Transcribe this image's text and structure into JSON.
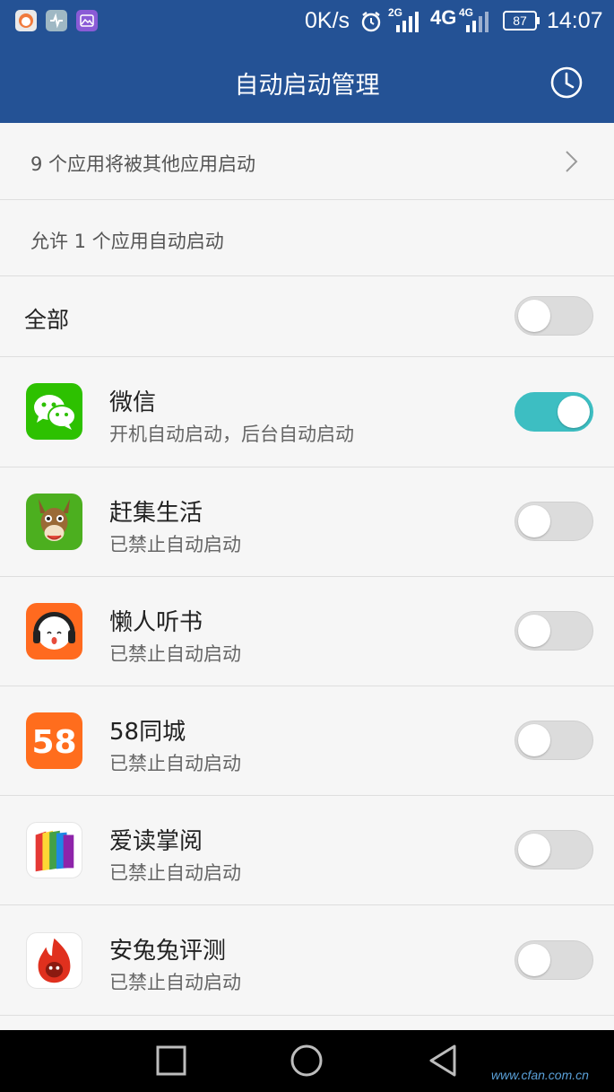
{
  "status_bar": {
    "speed": "0K/s",
    "net_2g": "2G",
    "net_4g": "4G",
    "net_4g_small": "4G",
    "battery": "87",
    "time": "14:07",
    "icons": [
      "headset-app-icon",
      "health-app-icon",
      "gallery-app-icon",
      "alarm-icon",
      "signal-icon",
      "battery-icon"
    ]
  },
  "header": {
    "title": "自动启动管理",
    "history_icon": "clock-icon"
  },
  "summary": {
    "launched_by_others": "9 个应用将被其他应用启动",
    "allowed_count": "允许 1 个应用自动启动"
  },
  "all_toggle": {
    "label": "全部",
    "on": false
  },
  "apps": [
    {
      "name": "微信",
      "status": "开机自动启动，后台自动启动",
      "on": true,
      "icon": "wechat-icon",
      "color": "#2dc100"
    },
    {
      "name": " 赶集生活",
      "status": "已禁止自动启动",
      "on": false,
      "icon": "donkey-icon",
      "color": "#4caf1f"
    },
    {
      "name": " 懒人听书",
      "status": "已禁止自动启动",
      "on": false,
      "icon": "headphones-icon",
      "color": "#ff6a1f"
    },
    {
      "name": "58同城",
      "status": "已禁止自动启动",
      "on": false,
      "icon": "58-icon",
      "color": "#ff6d1d"
    },
    {
      "name": "爱读掌阅",
      "status": "已禁止自动启动",
      "on": false,
      "icon": "book-icon",
      "color": "#f2a11f"
    },
    {
      "name": "安兔兔评测",
      "status": "已禁止自动启动",
      "on": false,
      "icon": "flame-icon",
      "color": "#e0301e"
    }
  ],
  "colors": {
    "accent": "#245295",
    "toggle_on": "#3dbec2",
    "toggle_off": "#dcdcdc"
  },
  "nav_icons": [
    "recents-icon",
    "home-icon",
    "back-icon"
  ],
  "watermark": "www.cfan.com.cn"
}
